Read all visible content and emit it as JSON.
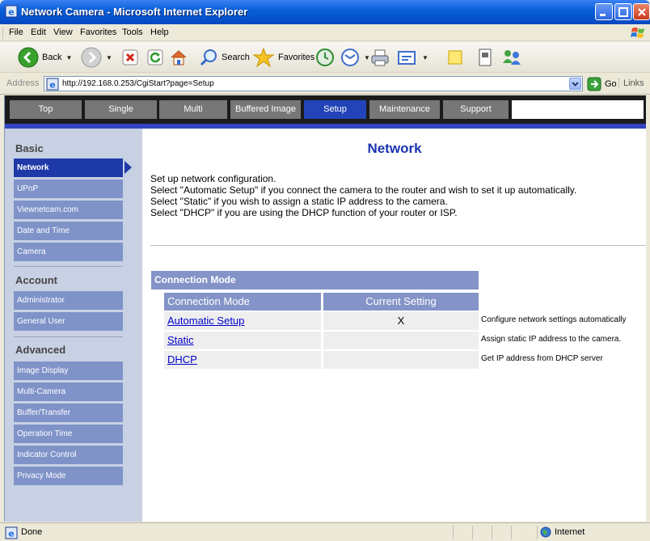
{
  "window": {
    "title": "Network Camera - Microsoft Internet Explorer"
  },
  "menu": {
    "items": [
      "File",
      "Edit",
      "View",
      "Favorites",
      "Tools",
      "Help"
    ]
  },
  "toolbar": {
    "back": "Back",
    "search": "Search",
    "favorites": "Favorites"
  },
  "address": {
    "label": "Address",
    "url": "http://192.168.0.253/CgiStart?page=Setup",
    "go": "Go",
    "links": "Links"
  },
  "nav": {
    "tabs": [
      "Top",
      "Single",
      "Multi",
      "Buffered Image",
      "Setup",
      "Maintenance",
      "Support"
    ],
    "active": "Setup"
  },
  "sidebar": {
    "sections": [
      {
        "heading": "Basic",
        "items": [
          "Network",
          "UPnP",
          "Viewnetcam.com",
          "Date and Time",
          "Camera"
        ]
      },
      {
        "heading": "Account",
        "items": [
          "Administrator",
          "General User"
        ]
      },
      {
        "heading": "Advanced",
        "items": [
          "Image Display",
          "Multi-Camera",
          "Buffer/Transfer",
          "Operation Time",
          "Indicator Control",
          "Privacy Mode"
        ]
      }
    ],
    "active": "Network"
  },
  "main": {
    "title": "Network",
    "description": [
      "Set up network configuration.",
      "Select \"Automatic Setup\" if you connect the camera to the router and wish to set it up automatically.",
      "Select \"Static\" if you wish to assign a static IP address to the camera.",
      "Select \"DHCP\" if you are using the DHCP function of your router or ISP."
    ],
    "connection": {
      "heading": "Connection Mode",
      "columns": [
        "Connection Mode",
        "Current Setting"
      ],
      "rows": [
        {
          "mode": "Automatic Setup",
          "current": "X",
          "note": "Configure network settings automatically"
        },
        {
          "mode": "Static",
          "current": "",
          "note": "Assign static IP address to the camera."
        },
        {
          "mode": "DHCP",
          "current": "",
          "note": "Get IP address from DHCP server"
        }
      ]
    }
  },
  "status": {
    "text": "Done",
    "zone": "Internet"
  },
  "colors": {
    "titlebar": "#0553d0",
    "nav_active": "#2244b8",
    "sidebar_bg": "#c8d1e4",
    "sidebar_item": "#7f93c9",
    "sidebar_active": "#1e3aa8",
    "table_head": "#8494c8",
    "title_text": "#1a33b0"
  }
}
